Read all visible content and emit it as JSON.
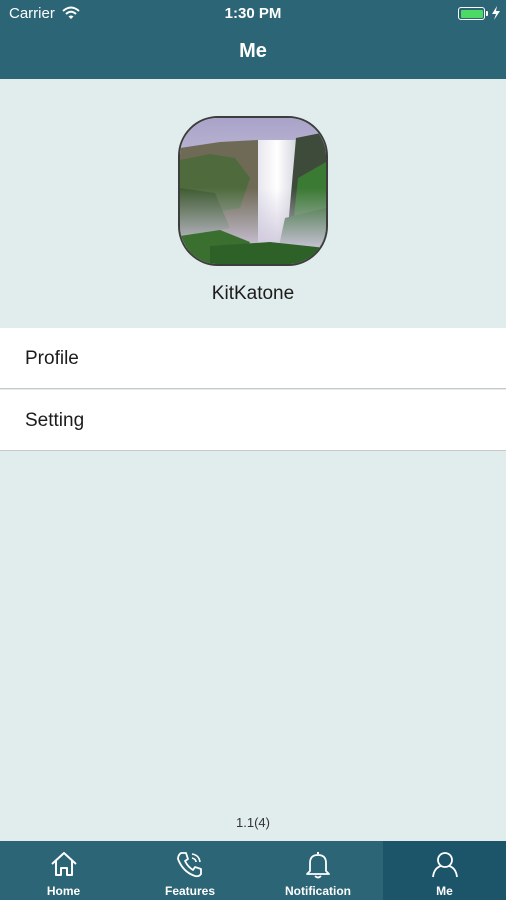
{
  "status_bar": {
    "carrier": "Carrier",
    "time": "1:30 PM",
    "battery_level": 1.0
  },
  "nav": {
    "title": "Me"
  },
  "profile": {
    "username": "KitKatone",
    "avatar_image": "waterfall landscape photo"
  },
  "menu": [
    {
      "label": "Profile"
    },
    {
      "label": "Setting"
    }
  ],
  "version": "1.1(4)",
  "tabs": [
    {
      "label": "Home",
      "icon": "home-icon"
    },
    {
      "label": "Features",
      "icon": "phone-icon"
    },
    {
      "label": "Notification",
      "icon": "bell-icon"
    },
    {
      "label": "Me",
      "icon": "person-icon",
      "selected": true
    }
  ],
  "colors": {
    "bar": "#2b6576",
    "tab_selected": "#1c5569",
    "background": "#e1ecec",
    "battery": "#4cd964"
  }
}
